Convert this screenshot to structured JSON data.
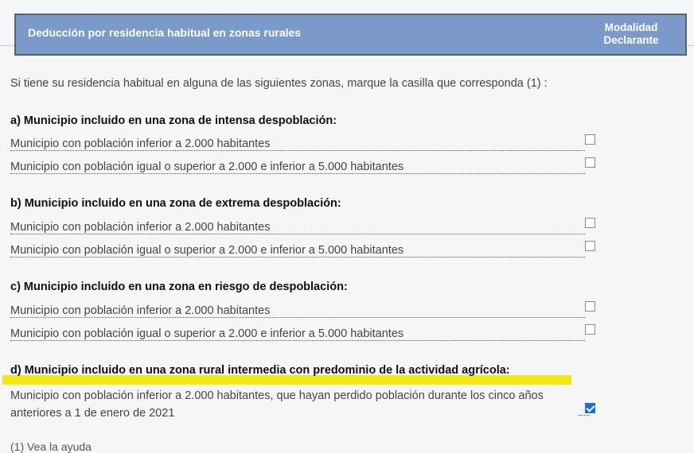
{
  "header": {
    "title": "Deducción por residencia habitual en zonas rurales",
    "modalidad_line1": "Modalidad",
    "modalidad_line2": "Declarante"
  },
  "intro": "Si tiene su residencia habitual en alguna de las siguientes zonas, marque la casilla que corresponda (1) :",
  "sections": [
    {
      "title": "a) Municipio incluido en una zona de intensa despoblación:",
      "rows": [
        {
          "label": "Municipio con población inferior a 2.000 habitantes",
          "checked": false
        },
        {
          "label": "Municipio con población igual o superior a 2.000 e inferior a 5.000 habitantes",
          "checked": false
        }
      ]
    },
    {
      "title": "b) Municipio incluido en una zona de extrema despoblación:",
      "rows": [
        {
          "label": "Municipio con población inferior a 2.000 habitantes",
          "checked": false
        },
        {
          "label": "Municipio con población igual o superior a 2.000 e inferior a 5.000 habitantes",
          "checked": false
        }
      ]
    },
    {
      "title": "c) Municipio incluido en una zona en riesgo de despoblación:",
      "rows": [
        {
          "label": "Municipio con población inferior a 2.000 habitantes",
          "checked": false
        },
        {
          "label": "Municipio con población igual o superior a 2.000 e inferior a 5.000 habitantes",
          "checked": false
        }
      ]
    },
    {
      "title": "d) Municipio incluido en una zona rural intermedia con predominio de la actividad agrícola:",
      "rows": [
        {
          "label_line1": "Municipio con población inferior a 2.000 habitantes, que hayan perdido población durante los cinco años",
          "label_line2": "anteriores a 1 de enero de 2021",
          "checked": true
        }
      ]
    }
  ],
  "footnote": "(1) Vea la ayuda",
  "colors": {
    "header_bg": "#7b99c9",
    "highlight": "#f1e816",
    "checkbox_checked": "#1f6fd1"
  }
}
